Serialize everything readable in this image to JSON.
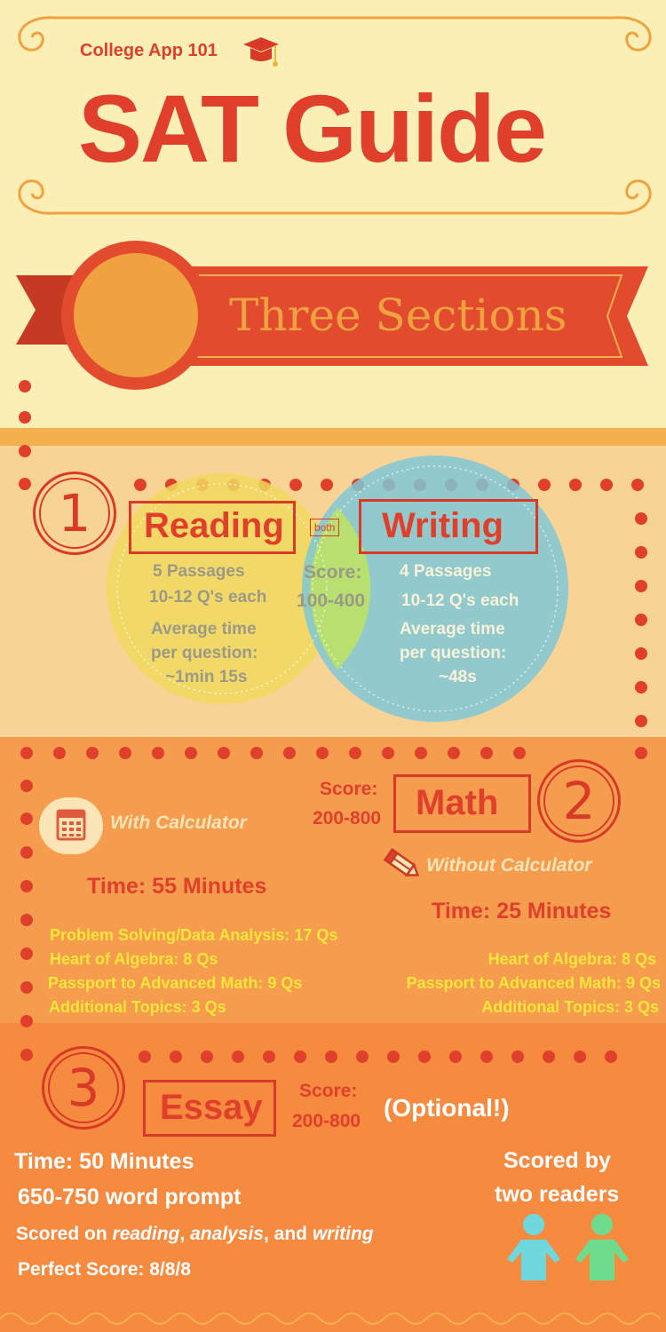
{
  "header": {
    "subtitle": "College App 101",
    "title": "SAT Guide",
    "banner": "Three Sections"
  },
  "reading_writing": {
    "number": "1",
    "reading_label": "Reading",
    "both_label": "both",
    "writing_label": "Writing",
    "reading_passages": "5 Passages",
    "reading_questions": "10-12 Q's each",
    "reading_time_1": "Average time",
    "reading_time_2": "per question:",
    "reading_time_3": "~1min 15s",
    "score_label": "Score:",
    "score_value": "100-400",
    "writing_passages": "4 Passages",
    "writing_questions": "10-12 Q's each",
    "writing_time_1": "Average time",
    "writing_time_2": "per question:",
    "writing_time_3": "~48s"
  },
  "math": {
    "number": "2",
    "label": "Math",
    "score_label": "Score:",
    "score_value": "200-800",
    "with_calc": "With Calculator",
    "with_time": "Time: 55 Minutes",
    "without_calc": "Without Calculator",
    "without_time": "Time: 25 Minutes",
    "with_items": [
      "Problem Solving/Data Analysis: 17 Qs",
      "Heart of Algebra: 8 Qs",
      "Passport to Advanced Math: 9 Qs",
      "Additional Topics: 3 Qs"
    ],
    "without_items": [
      "Heart of Algebra: 8 Qs",
      "Passport to Advanced Math: 9 Qs",
      "Additional Topics: 3 Qs"
    ]
  },
  "essay": {
    "number": "3",
    "label": "Essay",
    "score_label": "Score:",
    "score_value": "200-800",
    "optional": "(Optional!)",
    "time": "Time: 50 Minutes",
    "prompt": "650-750 word prompt",
    "scored_on_prefix": "Scored on ",
    "scored_on_reading": "reading",
    "scored_on_comma": ", ",
    "scored_on_analysis": "analysis",
    "scored_on_and": ", and ",
    "scored_on_writing": "writing",
    "perfect": "Perfect Score: 8/8/8",
    "readers_1": "Scored by",
    "readers_2": "two readers"
  },
  "colors": {
    "cream": "#fbefb6",
    "peach": "#f8d396",
    "orange_light": "#f59c4e",
    "orange_dark": "#f68a3f",
    "red": "#e0402b",
    "yellow_text": "#fbe63a",
    "reader_blue": "#6fd8df",
    "reader_green": "#6fdb8d"
  },
  "icons": [
    "graduation-cap-icon",
    "calculator-icon",
    "pencil-icon",
    "person-icon"
  ]
}
